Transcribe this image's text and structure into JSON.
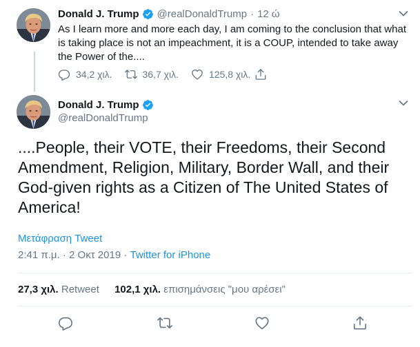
{
  "reply_tweet": {
    "author_name": "Donald J. Trump",
    "handle": "@realDonaldTrump",
    "separator": "·",
    "time_ago": "12 ώ",
    "text": "As I learn more and more each day, I am coming to the conclusion that what is taking place is not an impeachment, it is a COUP, intended to take away the Power of the....",
    "reply_count": "34,2 χιλ.",
    "retweet_count": "36,7 χιλ.",
    "like_count": "125,8 χιλ."
  },
  "main_tweet": {
    "author_name": "Donald J. Trump",
    "handle": "@realDonaldTrump",
    "text": "....People, their VOTE, their Freedoms, their Second Amendment, Religion, Military, Border Wall, and their God-given rights as a Citizen of The United States of America!",
    "translate_label": "Μετάφραση Tweet",
    "timestamp": "2:41 π.μ. · 2 Οκτ 2019",
    "meta_separator": " · ",
    "source": "Twitter for iPhone",
    "retweets_count": "27,3 χιλ.",
    "retweets_label": "Retweet",
    "likes_count": "102,1 χιλ.",
    "likes_label": "επισημάνσεις \"μου αρέσει\""
  },
  "icons": {
    "verified": "verified-badge-icon",
    "caret": "chevron-down-icon",
    "reply": "reply-icon",
    "retweet": "retweet-icon",
    "like": "heart-icon",
    "share": "share-icon"
  },
  "colors": {
    "accent": "#1da1f2",
    "link": "#1b95e0",
    "muted": "#657786",
    "text": "#14171a"
  }
}
